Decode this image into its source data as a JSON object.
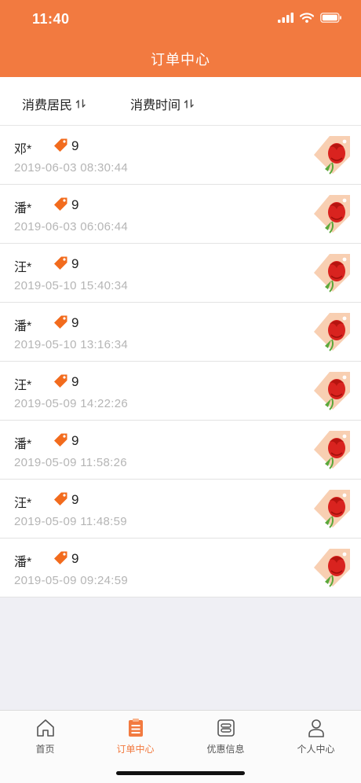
{
  "status_bar": {
    "time": "11:40"
  },
  "header": {
    "title": "订单中心"
  },
  "sort": {
    "resident_label": "消费居民",
    "time_label": "消费时间"
  },
  "orders": [
    {
      "name": "邓*",
      "count": "9",
      "time": "2019-06-03 08:30:44"
    },
    {
      "name": "潘*",
      "count": "9",
      "time": "2019-06-03 06:06:44"
    },
    {
      "name": "汪*",
      "count": "9",
      "time": "2019-05-10 15:40:34"
    },
    {
      "name": "潘*",
      "count": "9",
      "time": "2019-05-10 13:16:34"
    },
    {
      "name": "汪*",
      "count": "9",
      "time": "2019-05-09 14:22:26"
    },
    {
      "name": "潘*",
      "count": "9",
      "time": "2019-05-09 11:58:26"
    },
    {
      "name": "汪*",
      "count": "9",
      "time": "2019-05-09 11:48:59"
    },
    {
      "name": "潘*",
      "count": "9",
      "time": "2019-05-09 09:24:59"
    }
  ],
  "tabbar": {
    "items": [
      {
        "label": "首页",
        "icon": "home-icon"
      },
      {
        "label": "订单中心",
        "icon": "order-list-icon",
        "active": true
      },
      {
        "label": "优惠信息",
        "icon": "coupon-icon"
      },
      {
        "label": "个人中心",
        "icon": "person-icon"
      }
    ]
  },
  "colors": {
    "accent": "#f27a40",
    "tag": "#f26b1d",
    "rose": "#d9231f"
  }
}
